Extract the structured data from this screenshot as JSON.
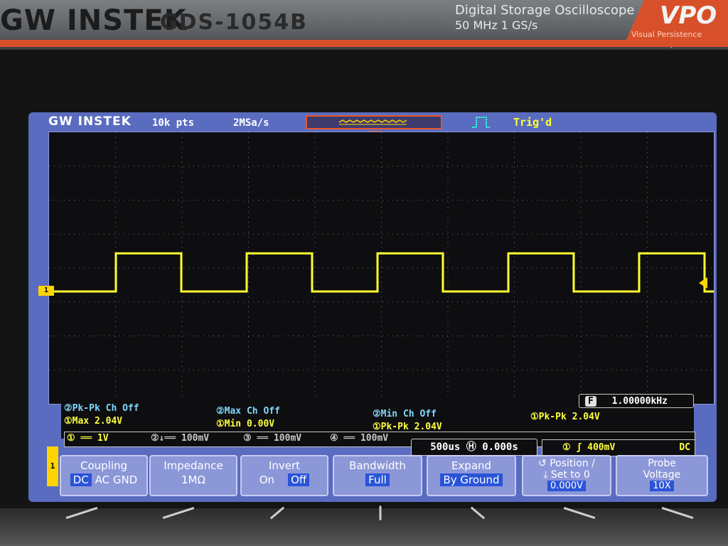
{
  "bezel": {
    "brand": "GW INSTEK",
    "model": "GDS-1054B",
    "description_line1": "Digital  Storage  Oscilloscope",
    "description_line2": "50 MHz   1 GS/s",
    "vpo_logo": "VPO",
    "vpo_subtitle": "Visual Persistence Oscilloscope"
  },
  "screen": {
    "logo": "GW INSTEK",
    "record_length": "10k pts",
    "sample_rate": "2MSa/s",
    "trigger_status": "Trig'd",
    "trigger_edge_icon": "rising-edge-icon"
  },
  "waveform": {
    "channel": "1",
    "channel_label": "1",
    "color": "#ffff30",
    "shape": "square",
    "frequency_display": "1.00000kHz",
    "high_level": "2.04V",
    "low_level": "0.00V"
  },
  "measurements": {
    "left": [
      {
        "text": "②Pk-Pk Ch Off",
        "color": "#7fd8ff"
      },
      {
        "text": "①Max 2.04V",
        "color": "#ffff40"
      }
    ],
    "middle": [
      {
        "text": "②Max Ch Off",
        "color": "#7fd8ff"
      },
      {
        "text": "①Min 0.00V",
        "color": "#ffff40"
      }
    ],
    "right": [
      {
        "text": "②Min Ch Off",
        "color": "#7fd8ff"
      },
      {
        "text": "①Pk-Pk 2.04V",
        "color": "#ffff40"
      }
    ],
    "far_right": "①Pk-Pk 2.04V",
    "frequency_label": "F",
    "frequency": "1.00000kHz"
  },
  "status_bar": {
    "ch1": "① ══  1V",
    "ch2": "②↓══  100mV",
    "ch3": "③ ══  100mV",
    "ch4": "④ ══  100mV",
    "timebase": "500us Ⓗ 0.000s",
    "trigger": "①  ʃ   400mV",
    "trigger_coupling": "DC"
  },
  "menu": {
    "channel_tab": "1",
    "coupling": {
      "title": "Coupling",
      "options": [
        "DC",
        "AC",
        "GND"
      ],
      "selected": "DC"
    },
    "impedance": {
      "title": "Impedance",
      "value": "1MΩ"
    },
    "invert": {
      "title": "Invert",
      "on": "On",
      "off": "Off",
      "selected": "Off"
    },
    "bandwidth": {
      "title": "Bandwidth",
      "value": "Full"
    },
    "expand": {
      "title": "Expand",
      "value": "By Ground"
    },
    "position": {
      "title": "↺ Position /",
      "subtitle": "⤓ Set to 0",
      "value": "0.000V"
    },
    "probe": {
      "title": "Probe",
      "subtitle": "Voltage",
      "value": "10X"
    }
  }
}
